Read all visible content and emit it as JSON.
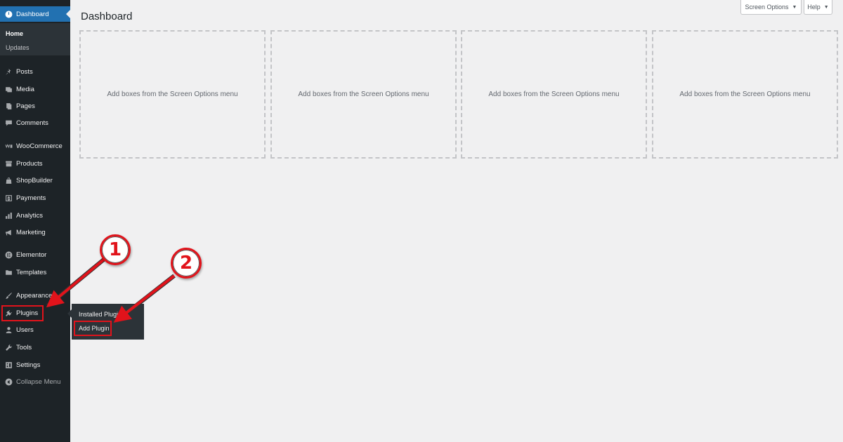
{
  "sidebar": {
    "dashboard_label": "Dashboard",
    "submenu": [
      "Home",
      "Updates"
    ],
    "items": [
      {
        "label": "Posts",
        "icon": "pin-icon"
      },
      {
        "label": "Media",
        "icon": "media-icon"
      },
      {
        "label": "Pages",
        "icon": "pages-icon"
      },
      {
        "label": "Comments",
        "icon": "comment-icon"
      },
      {
        "label": "WooCommerce",
        "icon": "woo-icon"
      },
      {
        "label": "Products",
        "icon": "archive-icon"
      },
      {
        "label": "ShopBuilder",
        "icon": "bag-icon"
      },
      {
        "label": "Payments",
        "icon": "payments-icon"
      },
      {
        "label": "Analytics",
        "icon": "bar-chart-icon"
      },
      {
        "label": "Marketing",
        "icon": "megaphone-icon"
      },
      {
        "label": "Elementor",
        "icon": "elementor-icon"
      },
      {
        "label": "Templates",
        "icon": "folder-icon"
      },
      {
        "label": "Appearance",
        "icon": "brush-icon"
      },
      {
        "label": "Plugins",
        "icon": "plug-icon"
      },
      {
        "label": "Users",
        "icon": "user-icon"
      },
      {
        "label": "Tools",
        "icon": "wrench-icon"
      },
      {
        "label": "Settings",
        "icon": "settings-icon"
      }
    ],
    "collapse_label": "Collapse Menu"
  },
  "flyout": {
    "installed_label": "Installed Plugins",
    "add_label": "Add Plugin"
  },
  "header": {
    "title": "Dashboard",
    "screen_options": "Screen Options",
    "help": "Help",
    "caret": "▼"
  },
  "boxes": [
    "Add boxes from the Screen Options menu",
    "Add boxes from the Screen Options menu",
    "Add boxes from the Screen Options menu",
    "Add boxes from the Screen Options menu"
  ],
  "callouts": [
    "1",
    "2"
  ],
  "colors": {
    "sidebar_bg": "#1d2327",
    "active_bg": "#2271b1",
    "highlight": "#e1131b",
    "page_bg": "#f0f0f1"
  }
}
